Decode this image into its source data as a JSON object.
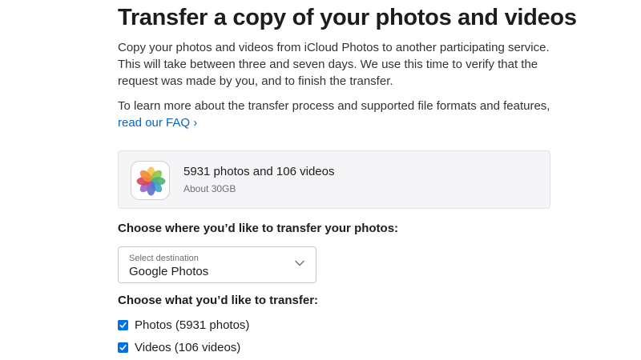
{
  "header": {
    "title": "Transfer a copy of your photos and videos"
  },
  "intro": {
    "text": "Copy your photos and videos from iCloud Photos to another participating service. This will take between three and seven days. We use this time to verify that the request was made by you, and to finish the transfer."
  },
  "faq": {
    "text": "To learn more about the transfer process and supported file formats and features, ",
    "link_label": "read our FAQ ›"
  },
  "summary": {
    "icon": "photos-app-icon",
    "count": "5931 photos and 106 videos",
    "size": "About 30GB"
  },
  "destination": {
    "heading": "Choose where you’d like to transfer your photos:",
    "select_label": "Select destination",
    "selected_value": "Google Photos",
    "icon": "chevron-down-icon"
  },
  "transfer_options": {
    "heading": "Choose what you’d like to transfer:",
    "items": [
      {
        "label": "Photos (5931 photos)",
        "checked": true
      },
      {
        "label": "Videos (106 videos)",
        "checked": true
      }
    ]
  },
  "colors": {
    "accent": "#0071e3",
    "link": "#0066cc",
    "card_background": "#f5f5f7"
  }
}
